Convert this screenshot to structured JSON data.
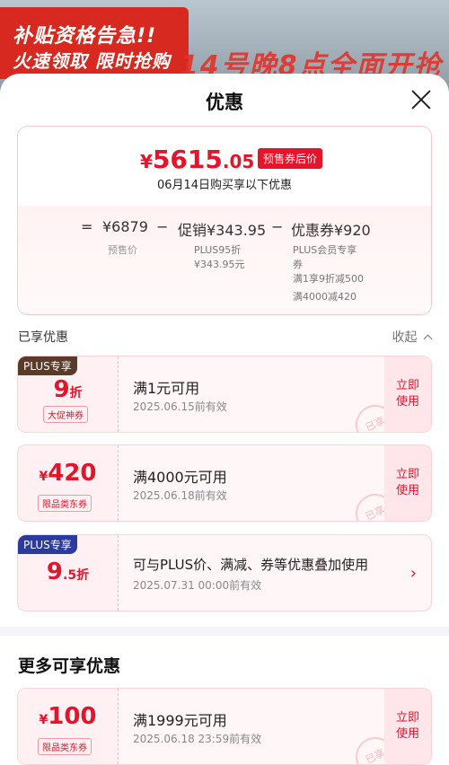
{
  "banner": {
    "line1": "补贴资格告急!!",
    "line2": "火速领取 限时抢购",
    "line3": "14号晚8点全面开抢"
  },
  "sheet": {
    "title": "优惠",
    "close_icon": "close-icon"
  },
  "summary": {
    "price_symbol": "¥",
    "price_int": "5615",
    "price_dec": ".05",
    "price_tag": "预售券后价",
    "purchase_date_text": "06月14日购买享以下优惠",
    "formula": {
      "eq": "=",
      "presale_price": "¥6879",
      "minus1": "−",
      "promo": "促销¥343.95",
      "minus2": "−",
      "coupon": "优惠券¥920"
    },
    "labels": {
      "presale_label": "预售价",
      "promo_line1": "PLUS95折",
      "promo_line2": "¥343.95元",
      "coupon_line1": "PLUS会员专享",
      "coupon_line2": "券",
      "coupon_line3": "满1享9折减500",
      "coupon_line4": "满4000减420"
    }
  },
  "enjoyed": {
    "label": "已享优惠",
    "collapse_label": "收起",
    "collapse_icon": "chevron-up-icon"
  },
  "coupons": [
    {
      "badge": "PLUS专享",
      "badge_color": "#5a3a28",
      "value": "9",
      "unit": "折",
      "unit_pos": "after",
      "category": "大促神券",
      "condition": "满1元可用",
      "expiry": "2025.06.15前有效",
      "action_line1": "立即",
      "action_line2": "使用",
      "stamp": "已享"
    },
    {
      "badge": "",
      "badge_color": "",
      "value": "420",
      "unit": "¥",
      "unit_pos": "before",
      "category": "限品类东券",
      "condition": "满4000元可用",
      "expiry": "2025.06.18前有效",
      "action_line1": "立即",
      "action_line2": "使用",
      "stamp": "已享"
    },
    {
      "badge": "PLUS专享",
      "badge_color": "#2b3a9c",
      "value": "9",
      "unit": ".5折",
      "unit_pos": "after",
      "category": "",
      "condition": "可与PLUS价、满减、券等优惠叠加使用",
      "expiry": "2025.07.31 00:00前有效",
      "action_line1": "",
      "action_line2": "",
      "stamp": "",
      "chevron": "›"
    }
  ],
  "more": {
    "title": "更多可享优惠",
    "coupon": {
      "value": "100",
      "unit": "¥",
      "category": "限品类东券",
      "condition": "满1999元可用",
      "expiry": "2025.06.18 23:59前有效",
      "action_line1": "立即",
      "action_line2": "使用",
      "stamp": "已享"
    }
  },
  "colors": {
    "accent": "#e4142b",
    "coupon_bg": "#fff6f7",
    "border": "#f7c9cf"
  }
}
